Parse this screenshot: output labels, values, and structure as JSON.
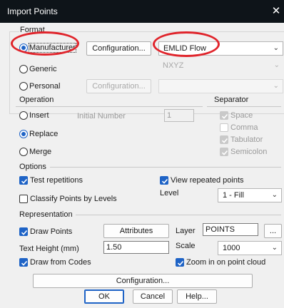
{
  "dialog": {
    "title": "Import Points",
    "close_glyph": "✕"
  },
  "format": {
    "group_label": "Format",
    "manufacturer_label": "Manufacturer",
    "generic_label": "Generic",
    "personal_label": "Personal",
    "configuration_button": "Configuration...",
    "configuration_button_disabled": "Configuration...",
    "manufacturer_value": "EMLID Flow",
    "generic_value": "NXYZ",
    "personal_value": "",
    "selected": "manufacturer"
  },
  "operation": {
    "group_label": "Operation",
    "insert_label": "Insert",
    "replace_label": "Replace",
    "merge_label": "Merge",
    "initial_number_label": "Initial Number",
    "initial_number_value": "1",
    "selected": "replace"
  },
  "separator": {
    "group_label": "Separator",
    "space_label": "Space",
    "comma_label": "Comma",
    "tabulator_label": "Tabulator",
    "semicolon_label": "Semicolon",
    "space_checked": true,
    "comma_checked": false,
    "tabulator_checked": true,
    "semicolon_checked": true
  },
  "options": {
    "group_label": "Options",
    "test_repetitions_label": "Test repetitions",
    "test_repetitions_checked": true,
    "view_repeated_label": "View repeated points",
    "view_repeated_checked": true,
    "classify_label": "Classify Points by Levels",
    "classify_checked": false,
    "level_label": "Level",
    "level_value": "1 - Fill"
  },
  "representation": {
    "group_label": "Representation",
    "draw_points_label": "Draw Points",
    "draw_points_checked": true,
    "attributes_button": "Attributes",
    "layer_label": "Layer",
    "layer_value": "POINTS",
    "layer_browse_button": "...",
    "text_height_label": "Text Height (mm)",
    "text_height_value": "1.50",
    "scale_label": "Scale",
    "scale_value": "1000",
    "draw_from_codes_label": "Draw from Codes",
    "draw_from_codes_checked": true,
    "zoom_label": "Zoom in on point cloud",
    "zoom_checked": true
  },
  "footer": {
    "configuration_button": "Configuration...",
    "ok_button": "OK",
    "cancel_button": "Cancel",
    "help_button": "Help..."
  },
  "icons": {
    "chevron": "chevron-down-icon",
    "check": "check-icon",
    "close": "close-icon"
  },
  "colors": {
    "accent": "#1e63c6",
    "highlight_ring": "#e0242b",
    "titlebar": "#0e1419",
    "client_bg": "#f0f0f0"
  }
}
